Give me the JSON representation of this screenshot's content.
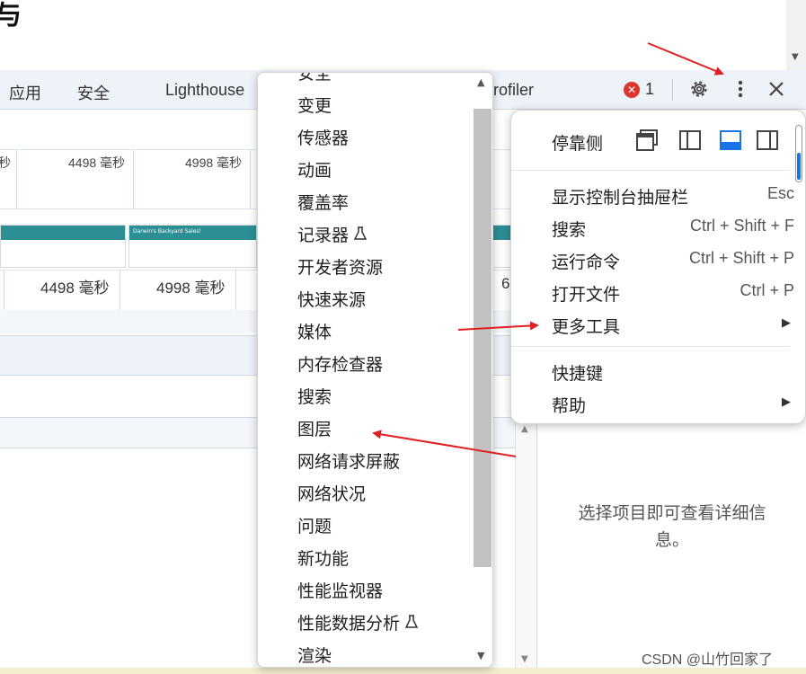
{
  "page": {
    "title_glyph": "与"
  },
  "tabbar": {
    "tabs": [
      "应用",
      "安全",
      "Lighthouse",
      "rofiler"
    ],
    "error_count": "1",
    "error_badge": "✕"
  },
  "timeline": {
    "row1": [
      "秒",
      "4498 毫秒",
      "4998 毫秒"
    ],
    "row2": [
      "4498 毫秒",
      "4998 毫秒",
      "6"
    ],
    "thumb_caption": "Darwin's Backyard Sales!"
  },
  "detail": {
    "message": "选择项目即可查看详细信息。"
  },
  "watermark": "CSDN @山竹回家了",
  "submenu": {
    "items": [
      {
        "label": "安全",
        "lab": false
      },
      {
        "label": "变更",
        "lab": false
      },
      {
        "label": "传感器",
        "lab": false
      },
      {
        "label": "动画",
        "lab": false
      },
      {
        "label": "覆盖率",
        "lab": false
      },
      {
        "label": "记录器",
        "lab": true
      },
      {
        "label": "开发者资源",
        "lab": false
      },
      {
        "label": "快速来源",
        "lab": false
      },
      {
        "label": "媒体",
        "lab": false
      },
      {
        "label": "内存检查器",
        "lab": false
      },
      {
        "label": "搜索",
        "lab": false
      },
      {
        "label": "图层",
        "lab": false
      },
      {
        "label": "网络请求屏蔽",
        "lab": false
      },
      {
        "label": "网络状况",
        "lab": false
      },
      {
        "label": "问题",
        "lab": false
      },
      {
        "label": "新功能",
        "lab": false
      },
      {
        "label": "性能监视器",
        "lab": false
      },
      {
        "label": "性能数据分析",
        "lab": true
      },
      {
        "label": "渲染",
        "lab": false
      }
    ],
    "lab_icon": "flask-icon"
  },
  "mainmenu": {
    "dock_label": "停靠侧",
    "dock_options": [
      "undock-icon",
      "dock-left-icon",
      "dock-bottom-icon",
      "dock-right-icon"
    ],
    "dock_selected": "dock-bottom-icon",
    "items": [
      {
        "label": "显示控制台抽屉栏",
        "shortcut": "Esc"
      },
      {
        "label": "搜索",
        "shortcut": "Ctrl + Shift + F"
      },
      {
        "label": "运行命令",
        "shortcut": "Ctrl + Shift + P"
      },
      {
        "label": "打开文件",
        "shortcut": "Ctrl + P"
      },
      {
        "label": "更多工具",
        "submenu": true
      },
      {
        "label": "快捷键"
      },
      {
        "label": "帮助",
        "submenu": true
      }
    ]
  },
  "colors": {
    "accent": "#1a73e8",
    "annotation": "#e02020",
    "error": "#dc362e"
  }
}
